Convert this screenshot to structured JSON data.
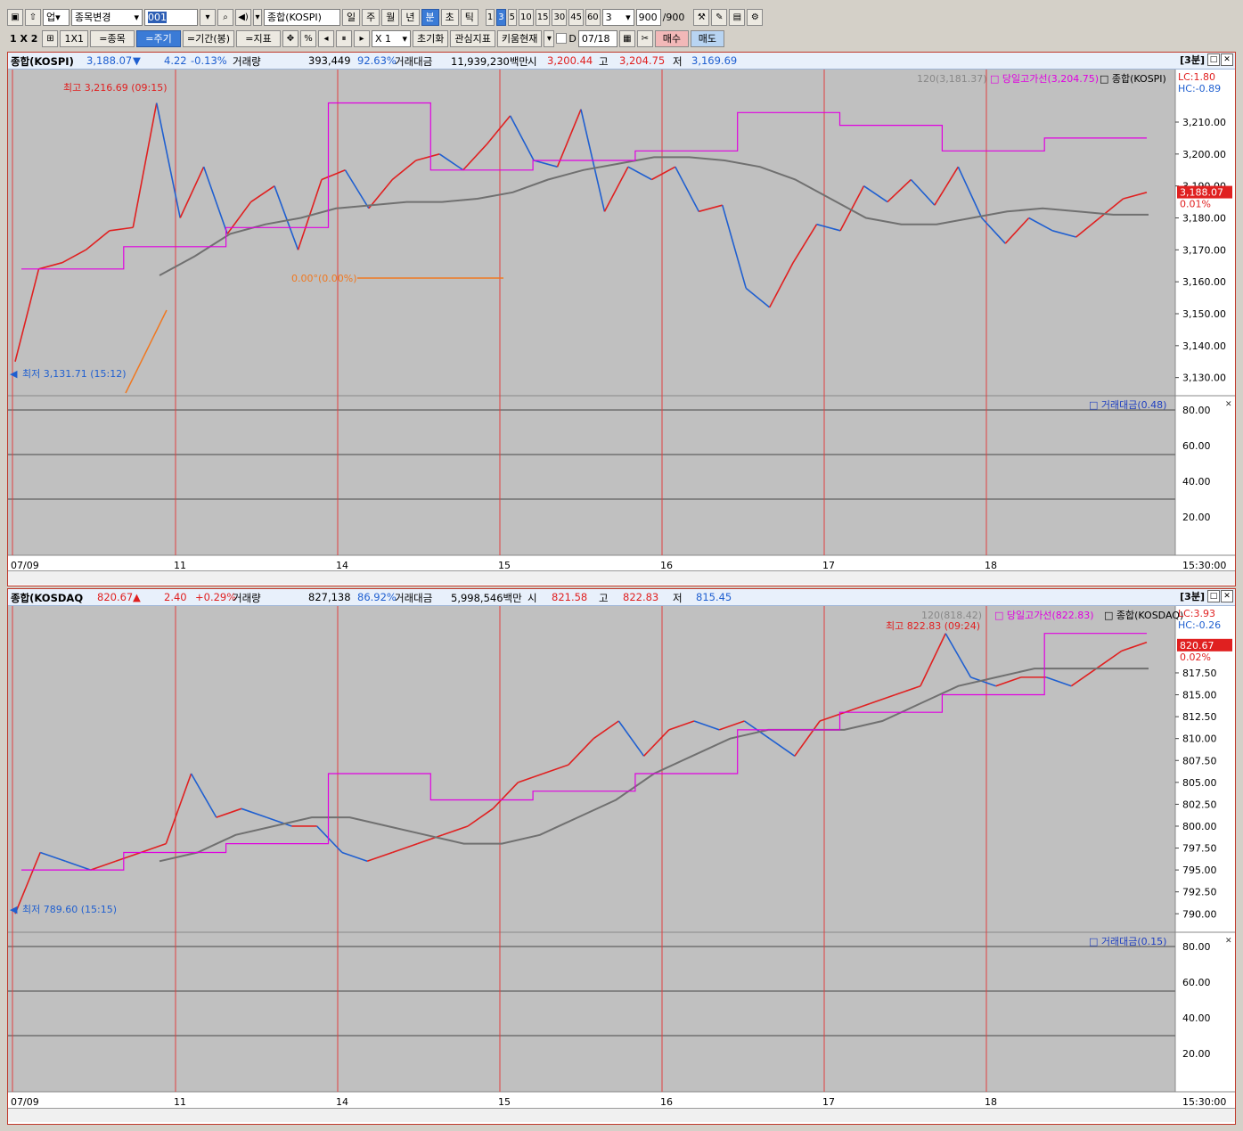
{
  "toolbar1": {
    "market": "업",
    "change_item": "종목변경",
    "code": "001",
    "item_name": "종합(KOSPI)",
    "periods": [
      "일",
      "주",
      "월",
      "년",
      "분",
      "초",
      "틱"
    ],
    "selected_period": "분",
    "minutes": [
      "1",
      "3",
      "5",
      "10",
      "15",
      "30",
      "45",
      "60"
    ],
    "selected_minute": "3",
    "minute_select": "3",
    "count": "900",
    "count_total": "/900"
  },
  "toolbar2": {
    "layout": "1 X 2",
    "layout2": "1X1",
    "btn_item": "=종목",
    "btn_cycle": "=주기",
    "btn_period": "=기간(봉)",
    "btn_indicator": "=지표",
    "percent": "%",
    "zoom": "X 1",
    "reset": "초기화",
    "watch_indicator": "관심지표",
    "kiwoom_now": "키움현재",
    "d_label": "D",
    "date": "07/18",
    "buy": "매수",
    "sell": "매도"
  },
  "colors": {
    "up": "#e02020",
    "down": "#1f5fd0",
    "magenta": "#e000e0",
    "ma": "#707070",
    "vline": "#e04040",
    "orange": "#f07820",
    "bg": "#c0c0c0"
  },
  "chart1": {
    "header": {
      "name": "종합(KOSPI)",
      "price": "3,188.07",
      "arrow": "▼",
      "change": "4.22",
      "rate": "-0.13%",
      "vol_label": "거래량",
      "vol": "393,449",
      "vol_rate": "92.63%",
      "amt_label": "거래대금",
      "amt": "11,939,230백만",
      "open_label": "시",
      "open": "3,200.44",
      "high_label": "고",
      "high": "3,204.75",
      "low_label": "저",
      "low": "3,169.69",
      "interval": "[3분]"
    },
    "legend_ma": "120(3,181.37)",
    "legend_hl": "당일고가선(3,204.75)",
    "legend_name": "종합(KOSPI)",
    "lc": "LC:1.80",
    "hc": "HC:-0.89",
    "price_tag": "3,188.07",
    "price_rate": "0.01%",
    "max_label": "최고 3,216.69 (09:15)",
    "min_label": "최저 3,131.71 (15:12)",
    "trend_label": "0.00°(0.00%)",
    "vol_panel_label": "거래대금(0.48)",
    "yticks": [
      "3,210.00",
      "3,200.00",
      "3,190.00",
      "3,180.00",
      "3,170.00",
      "3,160.00",
      "3,150.00",
      "3,140.00",
      "3,130.00"
    ],
    "vol_yticks": [
      "80.00",
      "60.00",
      "40.00",
      "20.00"
    ],
    "x_labels": [
      "07/09",
      "11",
      "14",
      "15",
      "16",
      "17",
      "18"
    ],
    "time_label": "15:30:00"
  },
  "chart2": {
    "header": {
      "name": "종합(KOSDAQ",
      "price": "820.67",
      "arrow": "▲",
      "change": "2.40",
      "rate": "+0.29%",
      "vol_label": "거래량",
      "vol": "827,138",
      "vol_rate": "86.92%",
      "amt_label": "거래대금",
      "amt": "5,998,546백만",
      "open_label": "시",
      "open": "821.58",
      "high_label": "고",
      "high": "822.83",
      "low_label": "저",
      "low": "815.45",
      "interval": "[3분]"
    },
    "legend_ma": "120(818.42)",
    "legend_hl": "당일고가선(822.83)",
    "legend_name": "종합(KOSDAQ)",
    "lc": "LC:3.93",
    "hc": "HC:-0.26",
    "price_tag": "820.67",
    "price_rate": "0.02%",
    "max_label": "최고 822.83 (09:24)",
    "min_label": "최저 789.60 (15:15)",
    "vol_panel_label": "거래대금(0.15)",
    "yticks": [
      "817.50",
      "815.00",
      "812.50",
      "810.00",
      "807.50",
      "805.00",
      "802.50",
      "800.00",
      "797.50",
      "795.00",
      "792.50",
      "790.00"
    ],
    "vol_yticks": [
      "80.00",
      "60.00",
      "40.00",
      "20.00"
    ],
    "x_labels": [
      "07/09",
      "11",
      "14",
      "15",
      "16",
      "17",
      "18"
    ],
    "time_label": "15:30:00"
  },
  "chart_data": [
    {
      "type": "line",
      "title": "종합(KOSPI)",
      "ylim": [
        3126,
        3222
      ],
      "x": [
        "07/09",
        "11",
        "14",
        "15",
        "16",
        "17",
        "18"
      ],
      "series": [
        {
          "name": "종합(KOSPI)",
          "values": [
            3135,
            3164,
            3166,
            3170,
            3176,
            3177,
            3216,
            3180,
            3196,
            3175,
            3185,
            3190,
            3170,
            3192,
            3195,
            3183,
            3192,
            3198,
            3200,
            3195,
            3203,
            3212,
            3198,
            3196,
            3214,
            3182,
            3196,
            3192,
            3196,
            3182,
            3184,
            3158,
            3152,
            3166,
            3178,
            3176,
            3190,
            3185,
            3192,
            3184,
            3196,
            3180,
            3172,
            3180,
            3176,
            3174,
            3180,
            3186,
            3188
          ]
        },
        {
          "name": "120",
          "values": [
            3162,
            3168,
            3175,
            3178,
            3180,
            3183,
            3184,
            3185,
            3185,
            3186,
            3188,
            3192,
            3195,
            3197,
            3199,
            3199,
            3198,
            3196,
            3192,
            3186,
            3180,
            3178,
            3178,
            3180,
            3182,
            3183,
            3182,
            3181,
            3181
          ]
        }
      ],
      "daily_high": [
        3164,
        3171,
        3177,
        3216,
        3195,
        3198,
        3201,
        3213,
        3209,
        3201,
        3205
      ]
    },
    {
      "type": "line",
      "title": "종합(KOSDAQ",
      "ylim": [
        788.5,
        823.5
      ],
      "x": [
        "07/09",
        "11",
        "14",
        "15",
        "16",
        "17",
        "18"
      ],
      "series": [
        {
          "name": "종합(KOSDAQ",
          "values": [
            790,
            797,
            796,
            795,
            796,
            797,
            798,
            806,
            801,
            802,
            801,
            800,
            800,
            797,
            796,
            797,
            798,
            799,
            800,
            802,
            805,
            806,
            807,
            810,
            812,
            808,
            811,
            812,
            811,
            812,
            810,
            808,
            812,
            813,
            814,
            815,
            816,
            822,
            817,
            816,
            817,
            817,
            816,
            818,
            820,
            821
          ]
        },
        {
          "name": "120",
          "values": [
            796,
            797,
            799,
            800,
            801,
            801,
            800,
            799,
            798,
            798,
            799,
            801,
            803,
            806,
            808,
            810,
            811,
            811,
            811,
            812,
            814,
            816,
            817,
            818,
            818,
            818,
            818
          ]
        }
      ],
      "daily_high": [
        795,
        797,
        798,
        806,
        803,
        804,
        806,
        811,
        813,
        815,
        822
      ]
    }
  ]
}
